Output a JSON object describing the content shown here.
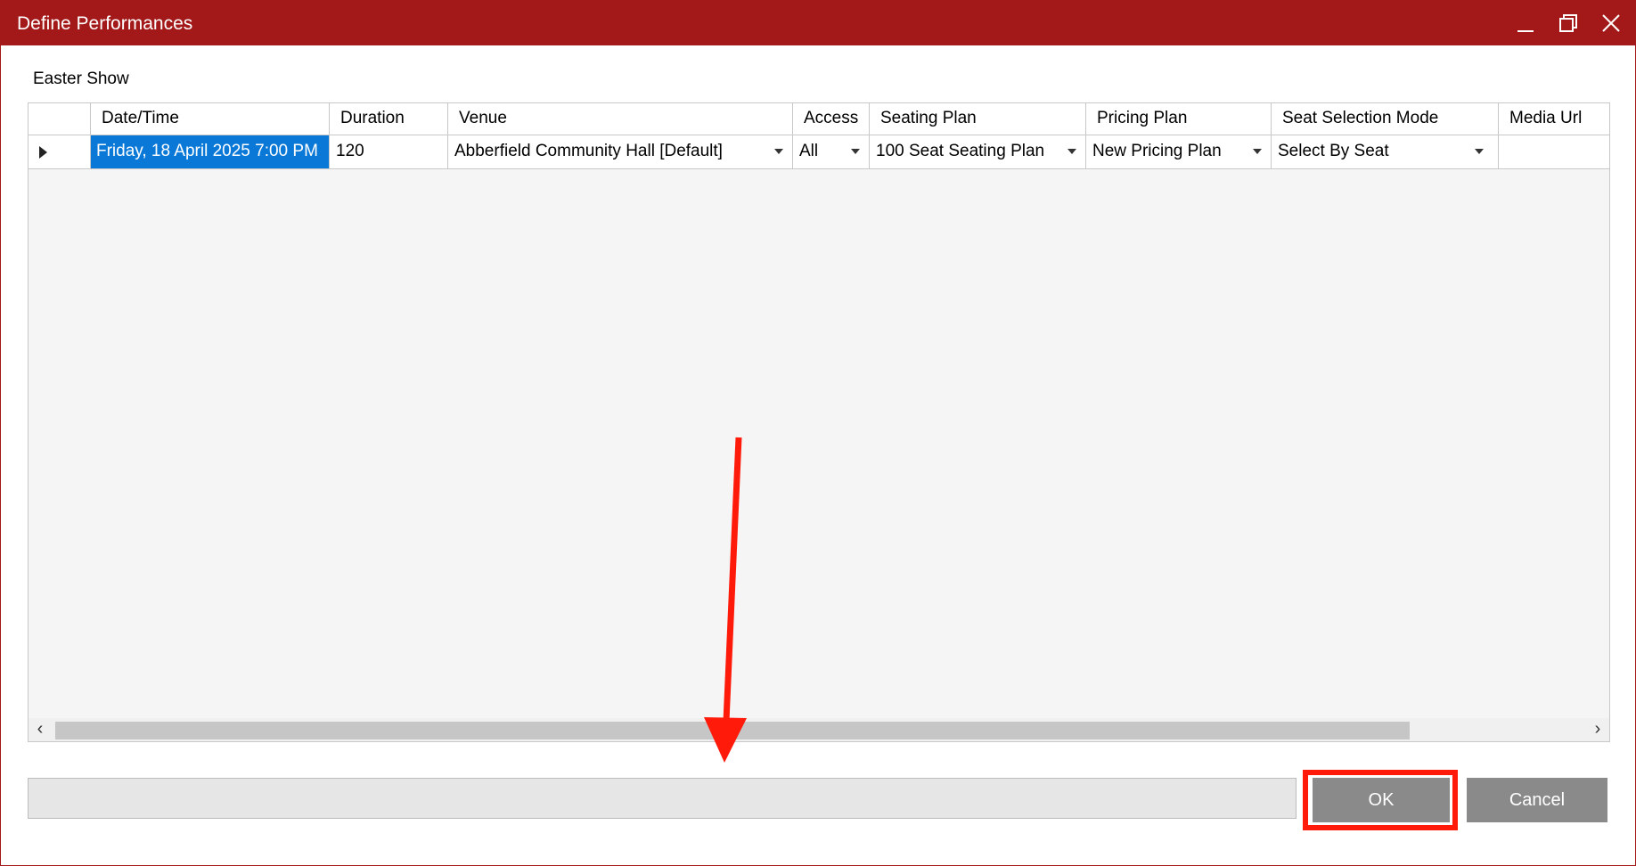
{
  "window": {
    "title": "Define Performances",
    "controls": [
      "minimize-icon",
      "maximize-icon",
      "close-icon"
    ],
    "accent_color": "#a31919"
  },
  "show_name": "Easter Show",
  "grid": {
    "columns": [
      "Date/Time",
      "Duration",
      "Venue",
      "Access",
      "Seating Plan",
      "Pricing Plan",
      "Seat Selection Mode",
      "Media Url"
    ],
    "rows": [
      {
        "date_time": "Friday, 18 April 2025 7:00 PM",
        "duration": "120",
        "venue": "Abberfield Community Hall [Default]",
        "access": "All",
        "seating_plan": "100 Seat Seating Plan",
        "pricing_plan": "New Pricing Plan",
        "seat_selection_mode": "Select By Seat",
        "media_url": ""
      }
    ],
    "selection_color": "#0a78d7"
  },
  "scrollbar": {
    "left_arrow": "‹",
    "right_arrow": "›"
  },
  "buttons": {
    "ok": "OK",
    "cancel": "Cancel"
  },
  "annotation": {
    "highlight_color": "#ff1a0a",
    "target": "ok-button"
  }
}
